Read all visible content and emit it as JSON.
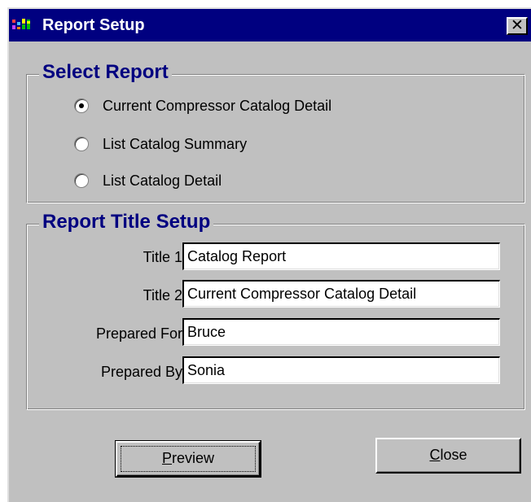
{
  "window": {
    "title": "Report Setup",
    "close_glyph": "✕",
    "icon": "app-icon"
  },
  "select_report": {
    "legend": "Select Report",
    "options": [
      {
        "label": "Current Compressor Catalog Detail",
        "checked": true
      },
      {
        "label": "List Catalog Summary",
        "checked": false
      },
      {
        "label": "List Catalog Detail",
        "checked": false
      }
    ]
  },
  "title_setup": {
    "legend": "Report Title Setup",
    "fields": [
      {
        "label": "Title 1",
        "value": "Catalog Report"
      },
      {
        "label": "Title 2",
        "value": "Current Compressor Catalog Detail"
      },
      {
        "label": "Prepared For",
        "value": "Bruce"
      },
      {
        "label": "Prepared By",
        "value": "Sonia"
      }
    ]
  },
  "buttons": {
    "preview": {
      "accel": "P",
      "rest": "review"
    },
    "close": {
      "accel": "C",
      "rest": "lose"
    }
  },
  "colors": {
    "title_bar": "#000080",
    "face": "#c0c0c0",
    "legend_text": "#000080"
  }
}
